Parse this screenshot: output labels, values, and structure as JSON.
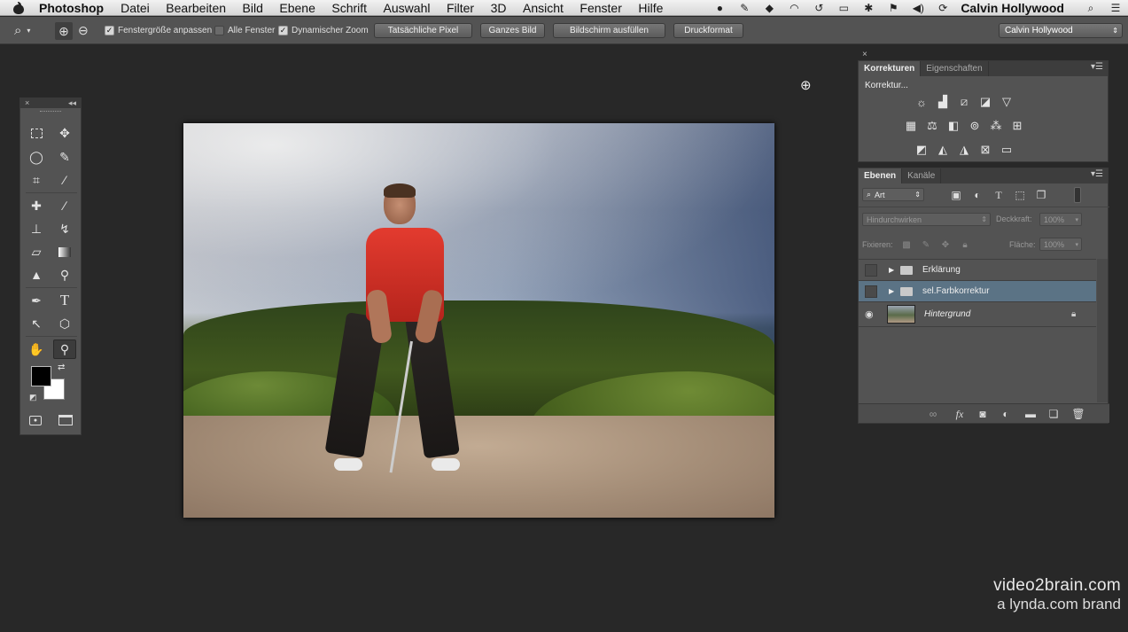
{
  "menubar": {
    "app_name": "Photoshop",
    "items": [
      "Datei",
      "Bearbeiten",
      "Bild",
      "Ebene",
      "Schrift",
      "Auswahl",
      "Filter",
      "3D",
      "Ansicht",
      "Fenster",
      "Hilfe"
    ],
    "user": "Calvin Hollywood"
  },
  "options_bar": {
    "fit_window_label": "Fenstergröße anpassen",
    "all_windows_label": "Alle Fenster",
    "scrubby_zoom_label": "Dynamischer Zoom",
    "actual_pixels": "Tatsächliche Pixel",
    "fit_screen": "Ganzes Bild",
    "fill_screen": "Bildschirm ausfüllen",
    "print_size": "Druckformat",
    "workspace": "Calvin Hollywood"
  },
  "adjustments_panel": {
    "tabs": [
      "Korrekturen",
      "Eigenschaften"
    ],
    "add_label": "Korrektur..."
  },
  "layers_panel": {
    "tabs": [
      "Ebenen",
      "Kanäle"
    ],
    "filter_kind": "Art",
    "blend_mode": "Hindurchwirken",
    "opacity_label": "Deckkraft:",
    "opacity_value": "100%",
    "lock_label": "Fixieren:",
    "fill_label": "Fläche:",
    "fill_value": "100%",
    "layers": [
      {
        "name": "Erklärung",
        "type": "group",
        "visible": false,
        "selected": false
      },
      {
        "name": "sel.Farbkorrektur",
        "type": "group",
        "visible": false,
        "selected": true
      },
      {
        "name": "Hintergrund",
        "type": "image",
        "visible": true,
        "selected": false,
        "locked": true
      }
    ]
  },
  "watermark": {
    "line1": "video2brain.com",
    "line2": "a lynda.com brand"
  }
}
